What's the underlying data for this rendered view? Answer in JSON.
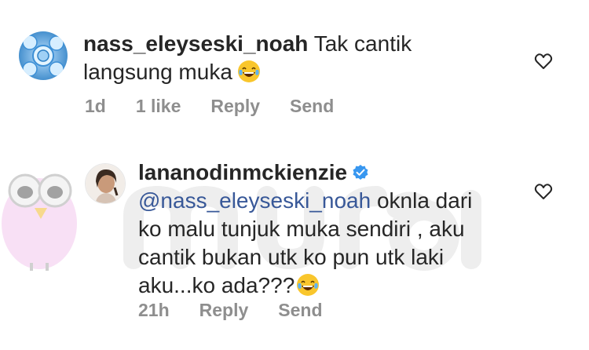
{
  "watermark": {
    "text": "murai"
  },
  "comments": [
    {
      "username": "nass_eleyseski_noah",
      "text_line1": "Tak cantik",
      "text_line2": "langsung muka",
      "time": "1d",
      "likes": "1 like",
      "reply": "Reply",
      "send": "Send"
    },
    {
      "username": "lananodinmckienzie",
      "mention": "@nass_eleyseski_noah",
      "text_line1": " oknla dari",
      "text_line2": "ko malu tunjuk muka sendiri , aku",
      "text_line3": "cantik bukan utk ko pun utk laki",
      "text_line4": "aku...ko ada???",
      "time": "21h",
      "reply": "Reply",
      "send": "Send"
    }
  ],
  "colors": {
    "meta": "#8e8e8e",
    "mention": "#385898",
    "verified": "#3897f0",
    "text": "#262626"
  }
}
